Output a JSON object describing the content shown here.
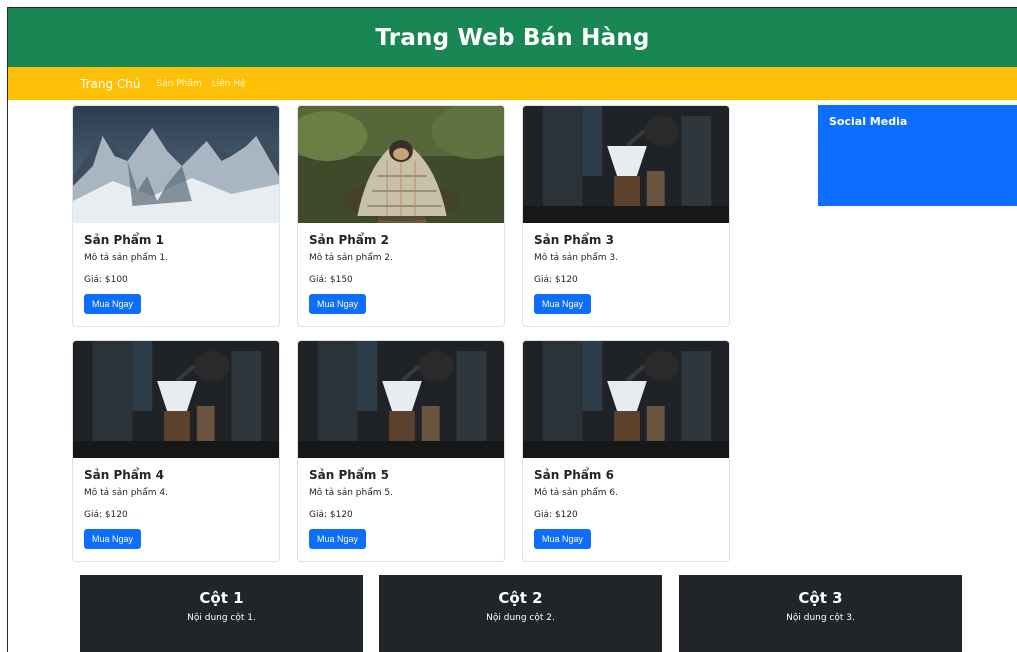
{
  "header": {
    "title": "Trang Web Bán Hàng"
  },
  "nav": {
    "home": "Trang Chủ",
    "products": "Sản Phẩm",
    "contact": "Liên Hệ"
  },
  "products": [
    {
      "title": "Sản Phẩm 1",
      "desc": "Mô tả sản phẩm 1.",
      "price": "Giá: $100",
      "button": "Mua Ngay",
      "image": "mountain-photo"
    },
    {
      "title": "Sản Phẩm 2",
      "desc": "Mô tả sản phẩm 2.",
      "price": "Giá: $150",
      "button": "Mua Ngay",
      "image": "dog-in-blanket-photo"
    },
    {
      "title": "Sản Phẩm 3",
      "desc": "Mô tả sản phẩm 3.",
      "price": "Giá: $120",
      "button": "Mua Ngay",
      "image": "coffee-photo"
    },
    {
      "title": "Sản Phẩm 4",
      "desc": "Mô tả sản phẩm 4.",
      "price": "Giá: $120",
      "button": "Mua Ngay",
      "image": "coffee-photo"
    },
    {
      "title": "Sản Phẩm 5",
      "desc": "Mô tả sản phẩm 5.",
      "price": "Giá: $120",
      "button": "Mua Ngay",
      "image": "coffee-photo"
    },
    {
      "title": "Sản Phẩm 6",
      "desc": "Mô tả sản phẩm 6.",
      "price": "Giá: $120",
      "button": "Mua Ngay",
      "image": "coffee-photo"
    }
  ],
  "sidebar": {
    "title": "Social Media"
  },
  "footer": {
    "columns": [
      {
        "title": "Cột 1",
        "content": "Nội dung cột 1."
      },
      {
        "title": "Cột 2",
        "content": "Nội dung cột 2."
      },
      {
        "title": "Cột 3",
        "content": "Nội dung cột 3."
      }
    ]
  },
  "colors": {
    "header_bg": "#198754",
    "nav_bg": "#ffc107",
    "primary": "#0d6efd",
    "footer_bg": "#212529"
  }
}
